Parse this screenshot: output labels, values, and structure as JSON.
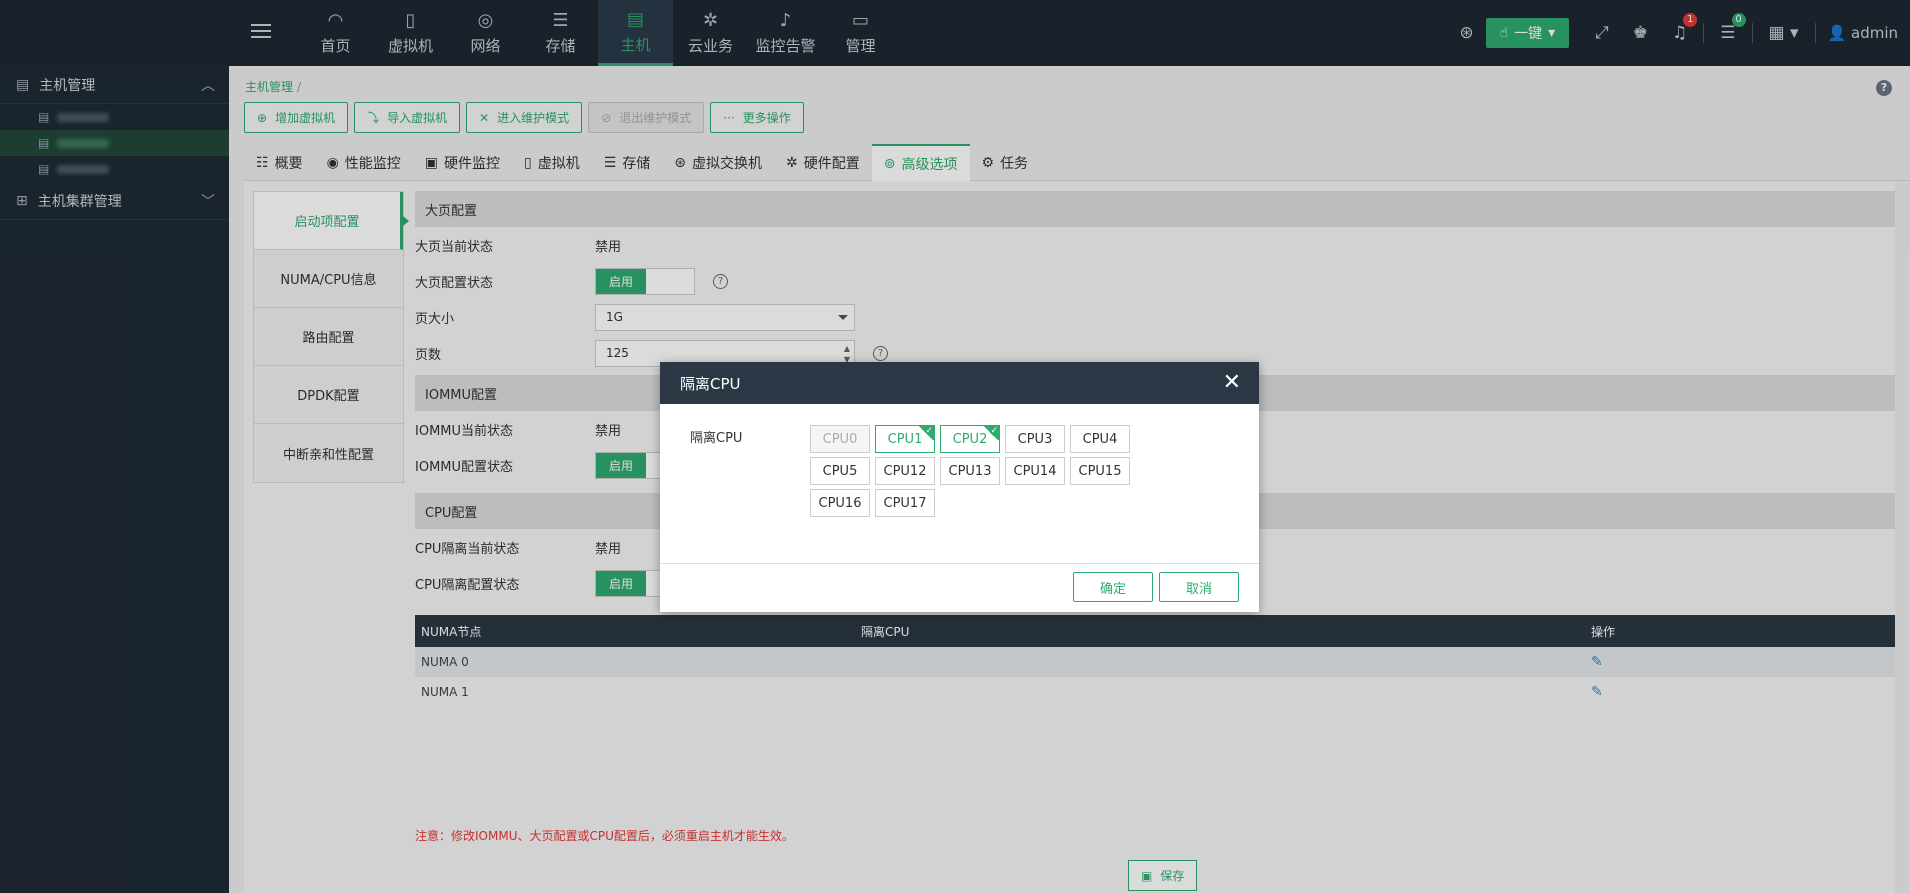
{
  "nav": {
    "items": [
      {
        "label": "首页",
        "icon": "dashboard-icon",
        "glyph": "◠"
      },
      {
        "label": "虚拟机",
        "icon": "vm-icon",
        "glyph": "▯"
      },
      {
        "label": "网络",
        "icon": "globe-icon",
        "glyph": "◎"
      },
      {
        "label": "存储",
        "icon": "database-icon",
        "glyph": "☰"
      },
      {
        "label": "主机",
        "icon": "server-icon",
        "glyph": "▤"
      },
      {
        "label": "云业务",
        "icon": "cog-icon",
        "glyph": "✲"
      },
      {
        "label": "监控告警",
        "icon": "bell-icon",
        "glyph": "♪"
      },
      {
        "label": "管理",
        "icon": "monitor-icon",
        "glyph": "▭"
      }
    ],
    "onekey_label": "一键",
    "notification_count": "1",
    "task_count": "0",
    "user": "admin"
  },
  "sidebar": {
    "group1": "主机管理",
    "group2": "主机集群管理"
  },
  "breadcrumb": {
    "root": "主机管理",
    "sep": "/"
  },
  "toolbar": {
    "add_vm": "增加虚拟机",
    "import_vm": "导入虚拟机",
    "enter_maint": "进入维护模式",
    "exit_maint": "退出维护模式",
    "more": "更多操作"
  },
  "tabs": [
    "概要",
    "性能监控",
    "硬件监控",
    "虚拟机",
    "存储",
    "虚拟交换机",
    "硬件配置",
    "高级选项",
    "任务"
  ],
  "vtabs": [
    "启动项配置",
    "NUMA/CPU信息",
    "路由配置",
    "DPDK配置",
    "中断亲和性配置"
  ],
  "form": {
    "hugepage_title": "大页配置",
    "hugepage_current_label": "大页当前状态",
    "hugepage_current_value": "禁用",
    "hugepage_config_label": "大页配置状态",
    "enable": "启用",
    "page_size_label": "页大小",
    "page_size_value": "1G",
    "page_count_label": "页数",
    "page_count_value": "125",
    "iommu_title": "IOMMU配置",
    "iommu_current_label": "IOMMU当前状态",
    "iommu_current_value": "禁用",
    "iommu_config_label": "IOMMU配置状态",
    "cpu_title": "CPU配置",
    "cpu_current_label": "CPU隔离当前状态",
    "cpu_current_value": "禁用",
    "cpu_config_label": "CPU隔离配置状态"
  },
  "table": {
    "headers": [
      "NUMA节点",
      "隔离CPU",
      "操作"
    ],
    "rows": [
      {
        "node": "NUMA 0",
        "cpus": ""
      },
      {
        "node": "NUMA 1",
        "cpus": ""
      }
    ]
  },
  "note": "注意：修改IOMMU、大页配置或CPU配置后，必须重启主机才能生效。",
  "save_label": "保存",
  "help_glyph": "?",
  "modal": {
    "title": "隔离CPU",
    "label": "隔离CPU",
    "cpus": [
      {
        "name": "CPU0",
        "state": "disabled"
      },
      {
        "name": "CPU1",
        "state": "selected"
      },
      {
        "name": "CPU2",
        "state": "selected"
      },
      {
        "name": "CPU3",
        "state": "normal"
      },
      {
        "name": "CPU4",
        "state": "normal"
      },
      {
        "name": "CPU5",
        "state": "normal"
      },
      {
        "name": "CPU12",
        "state": "normal"
      },
      {
        "name": "CPU13",
        "state": "normal"
      },
      {
        "name": "CPU14",
        "state": "normal"
      },
      {
        "name": "CPU15",
        "state": "normal"
      },
      {
        "name": "CPU16",
        "state": "normal"
      },
      {
        "name": "CPU17",
        "state": "normal"
      }
    ],
    "ok": "确定",
    "cancel": "取消"
  },
  "colors": {
    "accent": "#2eab6f",
    "topbar": "#1e2732",
    "sidebar": "#1f2a35",
    "alert": "#e53935"
  }
}
